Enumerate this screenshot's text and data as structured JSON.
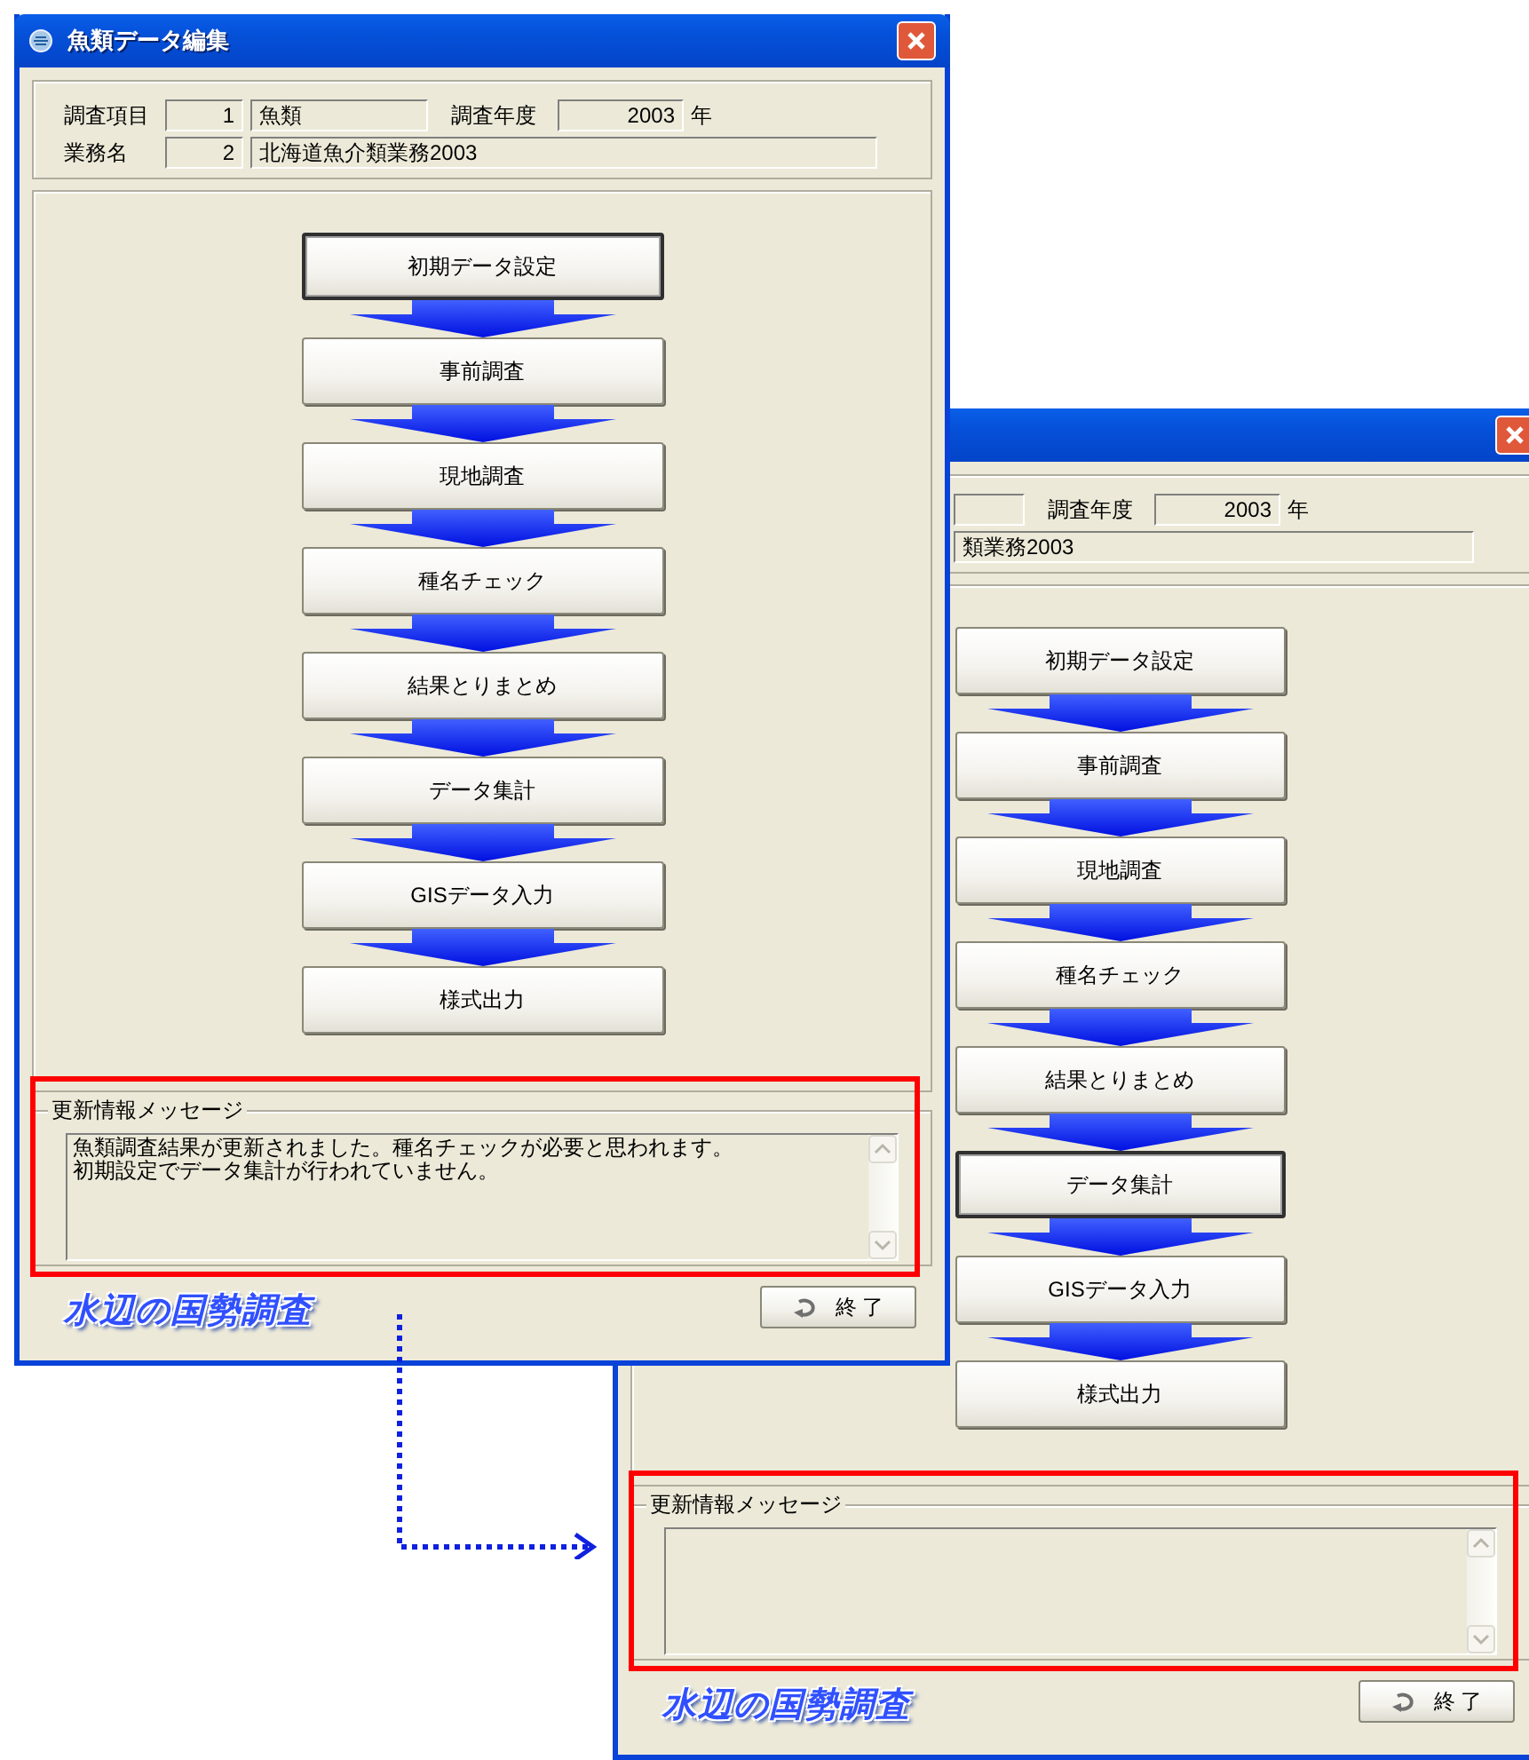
{
  "windows": [
    {
      "title": "魚類データ編集",
      "annotation_box": true,
      "fields": {
        "item_label": "調査項目",
        "item_no": "1",
        "item_name": "魚類",
        "year_label": "調査年度",
        "year": "2003",
        "year_unit": "年",
        "task_label": "業務名",
        "task_no": "2",
        "task_name": "北海道魚介類業務2003"
      },
      "steps": [
        {
          "label": "初期データ設定",
          "selected": true
        },
        {
          "label": "事前調査",
          "selected": false
        },
        {
          "label": "現地調査",
          "selected": false
        },
        {
          "label": "種名チェック",
          "selected": false
        },
        {
          "label": "結果とりまとめ",
          "selected": false
        },
        {
          "label": "データ集計",
          "selected": false
        },
        {
          "label": "GISデータ入力",
          "selected": false
        },
        {
          "label": "様式出力",
          "selected": false
        }
      ],
      "message": {
        "legend": "更新情報メッセージ",
        "lines": [
          "魚類調査結果が更新されました。種名チェックが必要と思われます。",
          "初期設定でデータ集計が行われていません。"
        ]
      },
      "logo": "水辺の国勢調査",
      "exit_button": "終 了"
    },
    {
      "annotation_box": true,
      "fields": {
        "year_label": "調査年度",
        "year": "2003",
        "year_unit": "年",
        "task_name": "類業務2003"
      },
      "steps": [
        {
          "label": "初期データ設定",
          "selected": false
        },
        {
          "label": "事前調査",
          "selected": false
        },
        {
          "label": "現地調査",
          "selected": false
        },
        {
          "label": "種名チェック",
          "selected": false
        },
        {
          "label": "結果とりまとめ",
          "selected": false
        },
        {
          "label": "データ集計",
          "selected": true
        },
        {
          "label": "GISデータ入力",
          "selected": false
        },
        {
          "label": "様式出力",
          "selected": false
        }
      ],
      "message": {
        "legend": "更新情報メッセージ"
      },
      "logo": "水辺の国勢調査",
      "exit_button": "終 了"
    }
  ]
}
